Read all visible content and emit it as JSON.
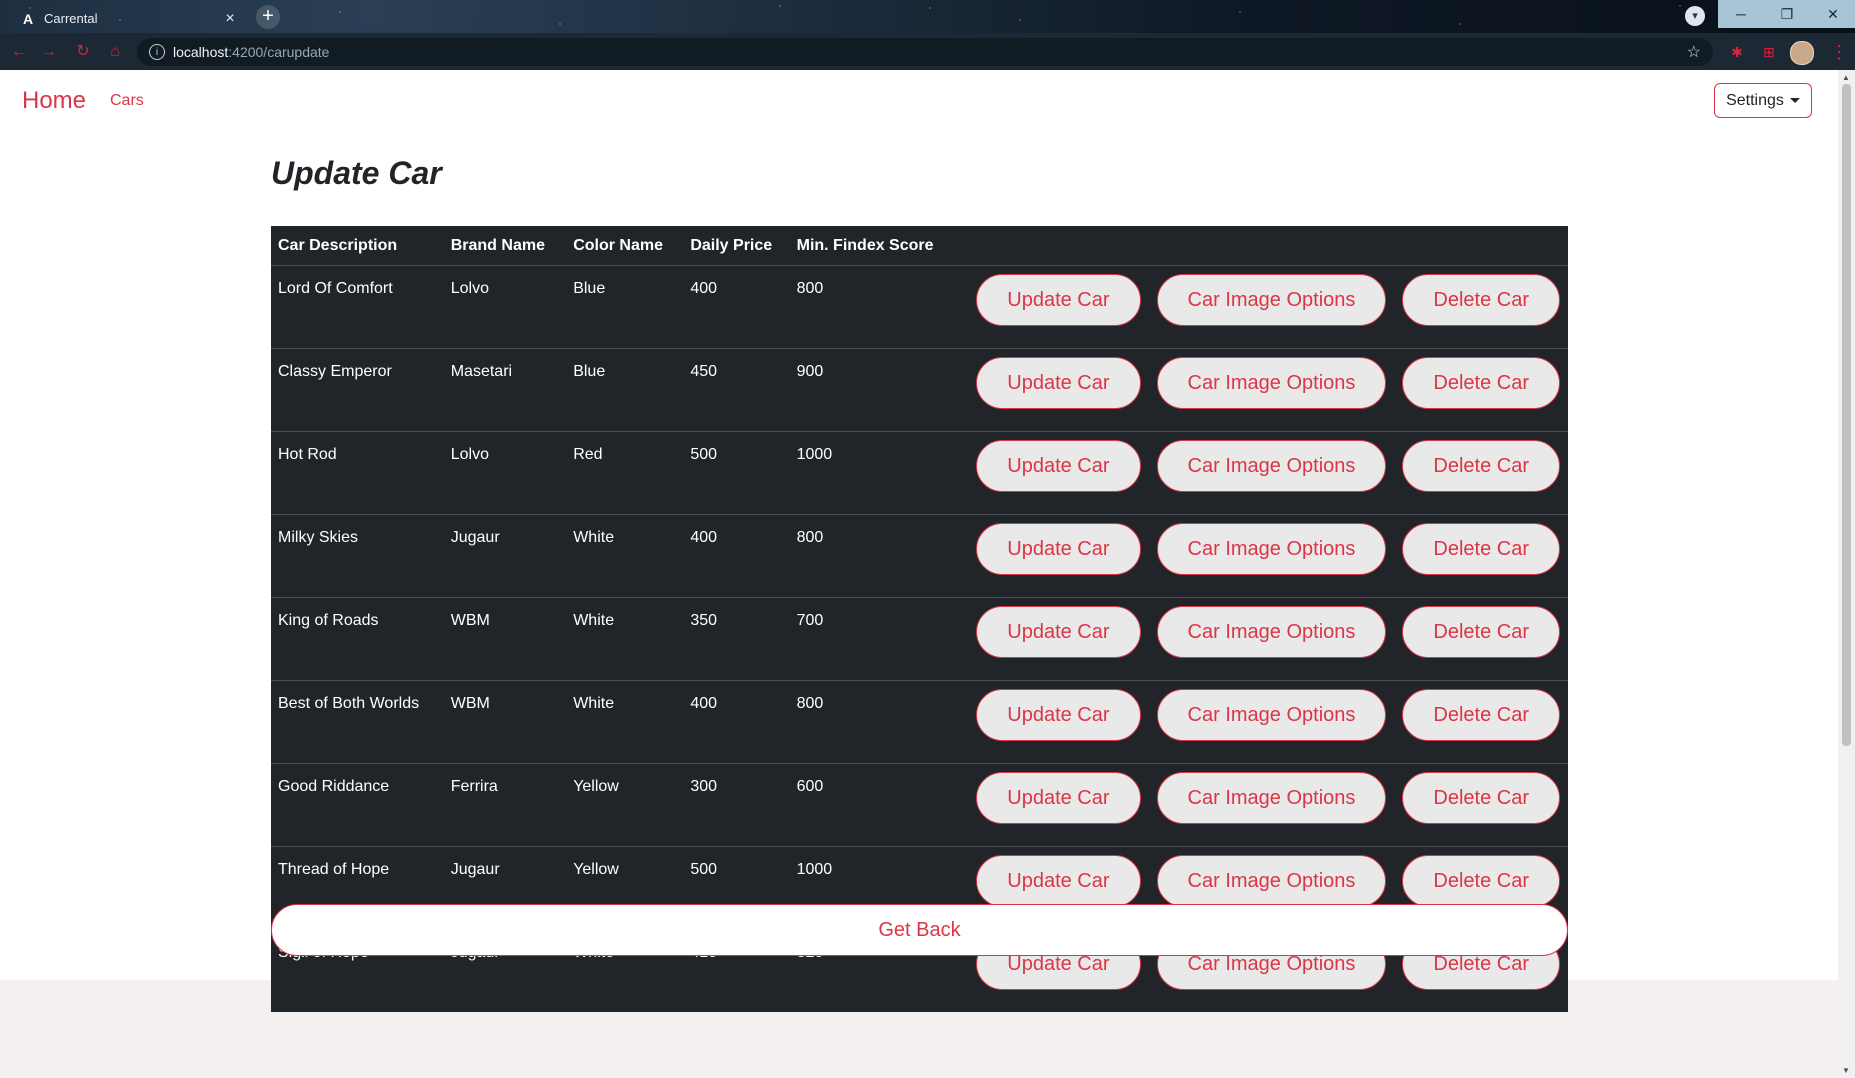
{
  "browser": {
    "tab_title": "Carrental",
    "tab_close": "×",
    "new_tab": "+",
    "url_host": "localhost",
    "url_path": ":4200/carupdate"
  },
  "navbar": {
    "home_label": "Home",
    "cars_label": "Cars",
    "settings_label": "Settings"
  },
  "page": {
    "title": "Update Car",
    "get_back_label": "Get Back"
  },
  "table": {
    "headers": [
      "Car Description",
      "Brand Name",
      "Color Name",
      "Daily Price",
      "Min. Findex Score"
    ],
    "actions": {
      "update": "Update Car",
      "images": "Car Image Options",
      "delete": "Delete Car"
    },
    "rows": [
      {
        "description": "Lord Of Comfort",
        "brand": "Lolvo",
        "color": "Blue",
        "price": "400",
        "findex": "800"
      },
      {
        "description": "Classy Emperor",
        "brand": "Masetari",
        "color": "Blue",
        "price": "450",
        "findex": "900"
      },
      {
        "description": "Hot Rod",
        "brand": "Lolvo",
        "color": "Red",
        "price": "500",
        "findex": "1000"
      },
      {
        "description": "Milky Skies",
        "brand": "Jugaur",
        "color": "White",
        "price": "400",
        "findex": "800"
      },
      {
        "description": "King of Roads",
        "brand": "WBM",
        "color": "White",
        "price": "350",
        "findex": "700"
      },
      {
        "description": "Best of Both Worlds",
        "brand": "WBM",
        "color": "White",
        "price": "400",
        "findex": "800"
      },
      {
        "description": "Good Riddance",
        "brand": "Ferrira",
        "color": "Yellow",
        "price": "300",
        "findex": "600"
      },
      {
        "description": "Thread of Hope",
        "brand": "Jugaur",
        "color": "Yellow",
        "price": "500",
        "findex": "1000"
      },
      {
        "description": "Sigil of Hope",
        "brand": "Jugaur",
        "color": "White",
        "price": "410",
        "findex": "820"
      }
    ]
  },
  "colors": {
    "accent": "#dc3545",
    "table_bg": "#212529",
    "button_bg": "#e9e9ea"
  }
}
